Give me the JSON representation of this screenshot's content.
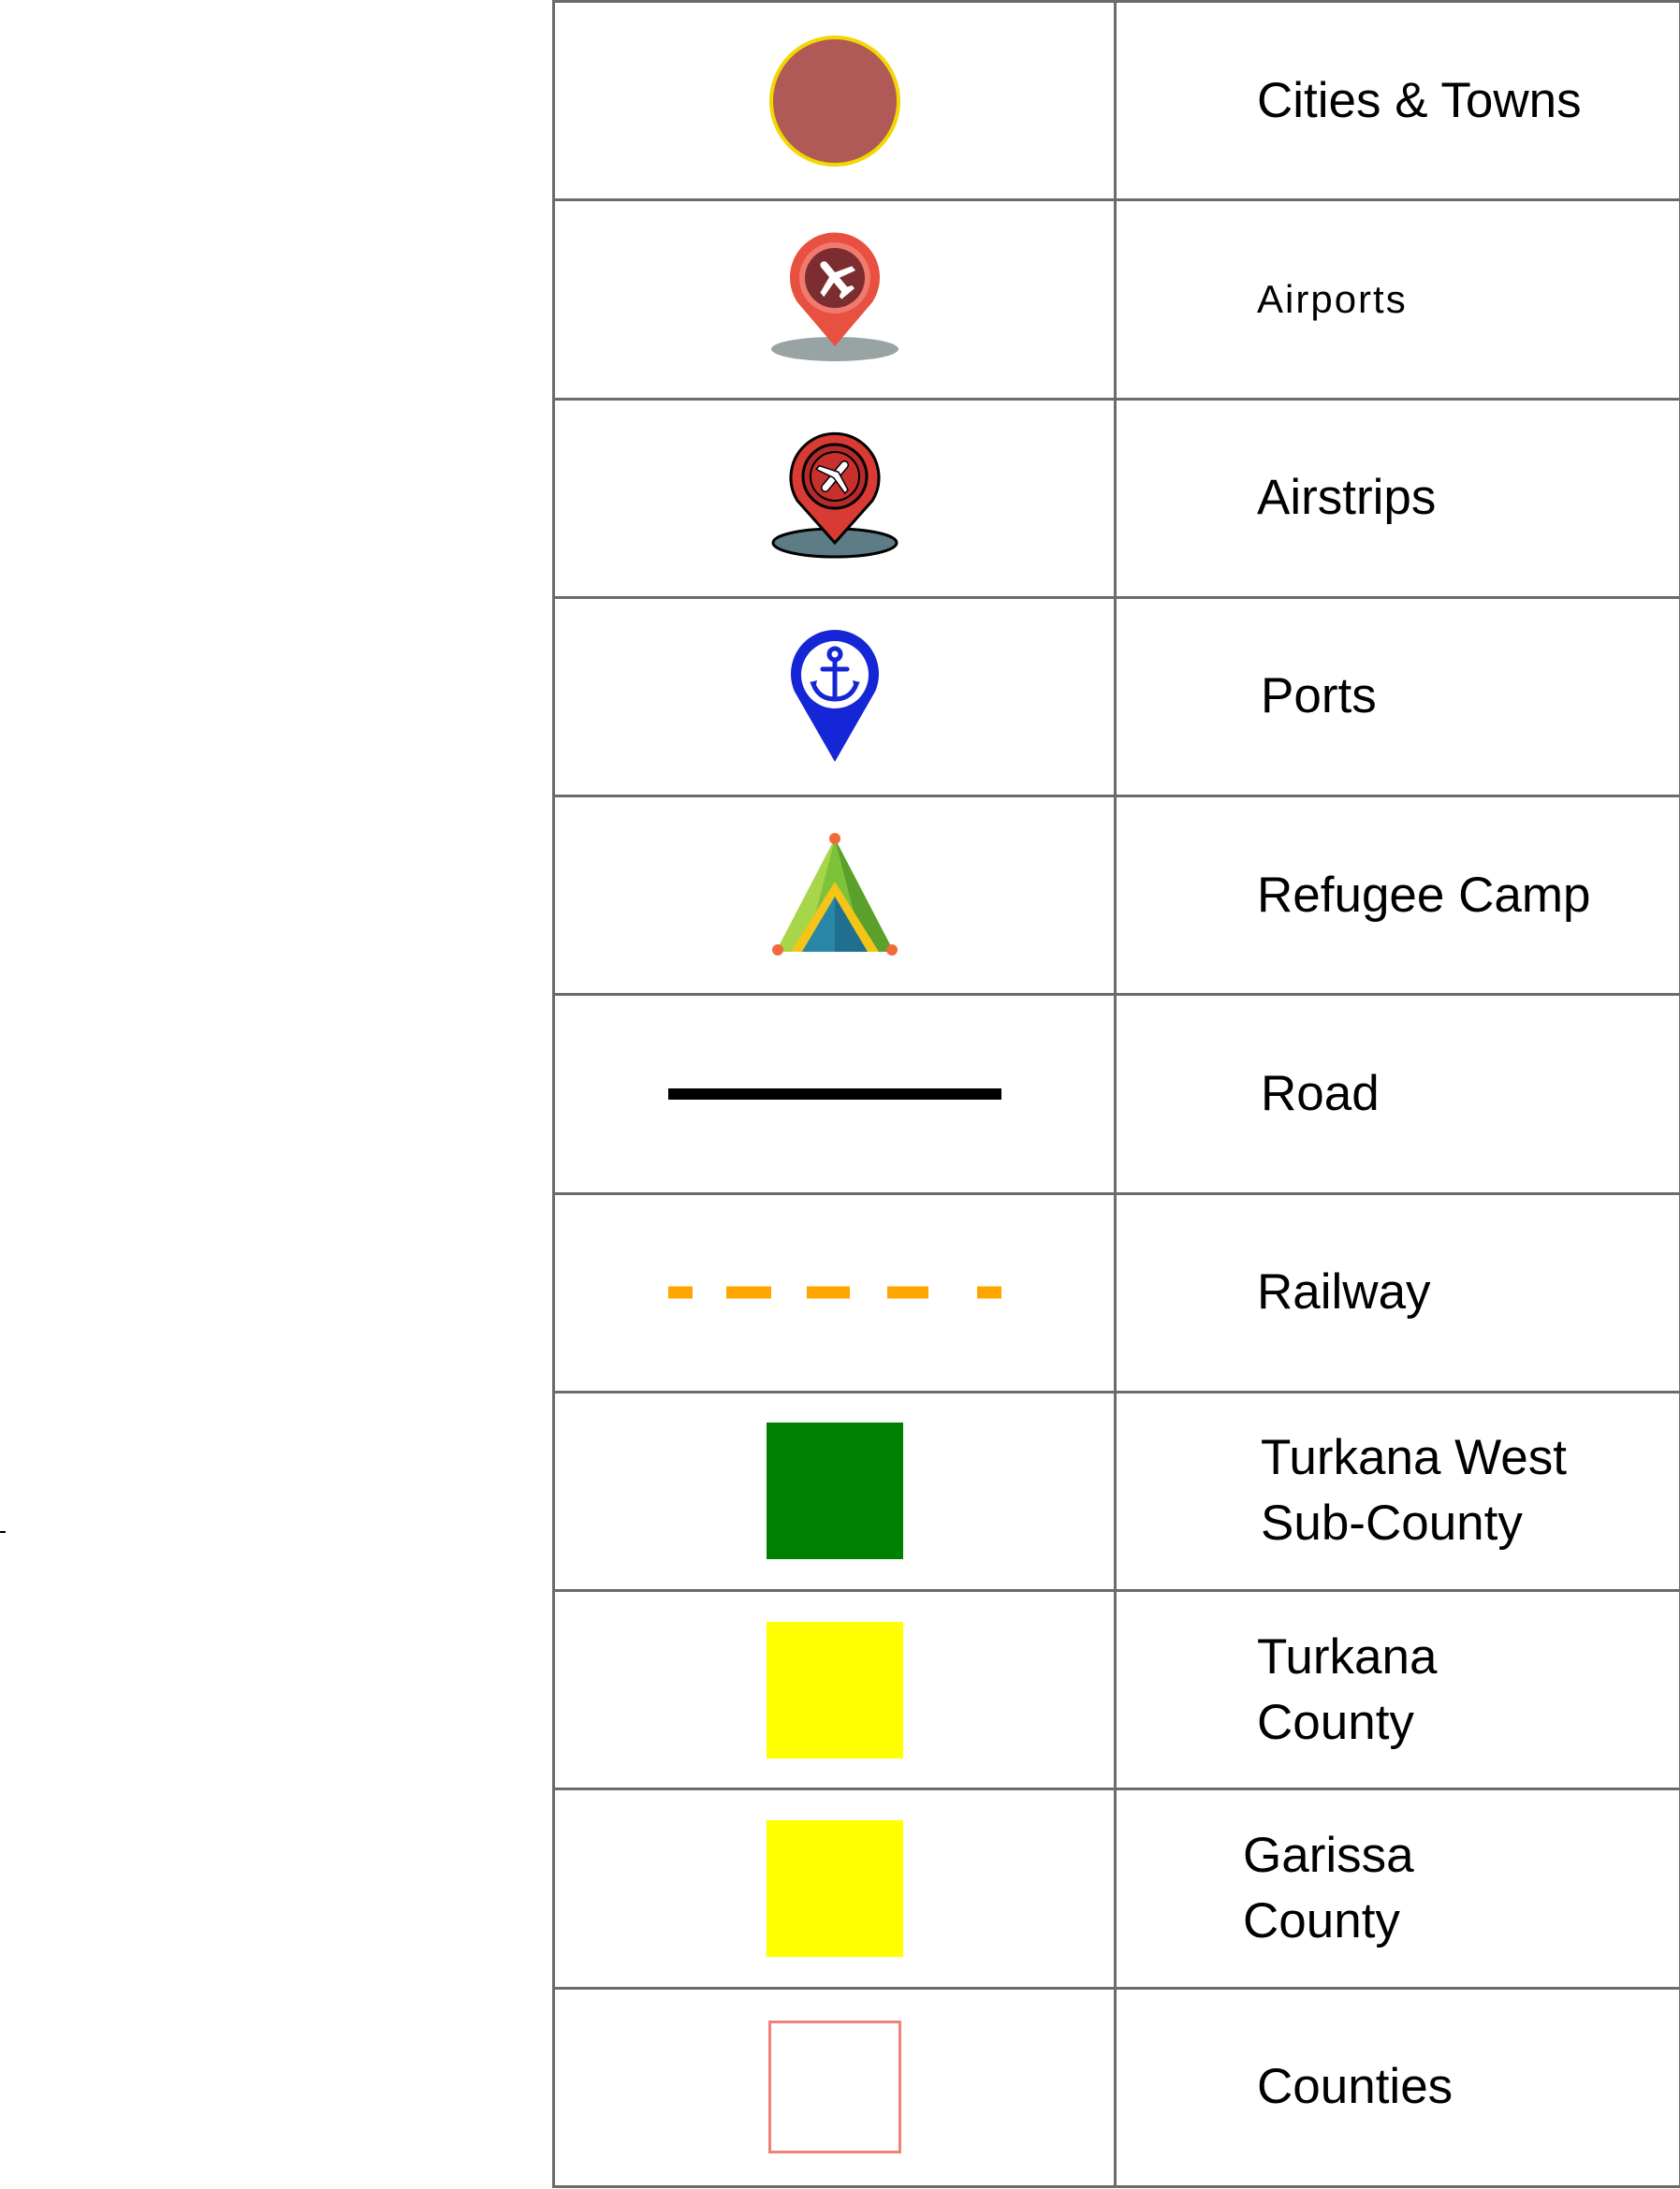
{
  "legend": {
    "rows": [
      {
        "label": "Cities & Towns",
        "icon": "city-circle-icon"
      },
      {
        "label": "Airports",
        "icon": "airport-pin-icon"
      },
      {
        "label": "Airstrips",
        "icon": "airstrip-pin-icon"
      },
      {
        "label": "Ports",
        "icon": "anchor-pin-icon"
      },
      {
        "label": "Refugee Camp",
        "icon": "tent-icon"
      },
      {
        "label": "Road",
        "icon": "road-line-icon"
      },
      {
        "label": "Railway",
        "icon": "railway-dashed-line-icon"
      },
      {
        "label": "Turkana West\nSub-County",
        "icon": "dark-green-square-icon"
      },
      {
        "label": "Turkana\nCounty",
        "icon": "yellow-square-icon"
      },
      {
        "label": "Garissa\nCounty",
        "icon": "yellow-square-icon"
      },
      {
        "label": "Counties",
        "icon": "outline-square-icon"
      }
    ]
  },
  "colors": {
    "city_fill": "#b05a57",
    "city_stroke": "#f2d700",
    "airport_pin": "#e8503f",
    "airstrip_pin": "#d93a33",
    "port_pin": "#1526d6",
    "road": "#000000",
    "railway": "#ffa500",
    "turkana_west": "#008000",
    "turkana_county": "#ffff00",
    "garissa_county": "#ffff00",
    "counties_outline": "#f08078",
    "grid": "#6b6b6b"
  }
}
